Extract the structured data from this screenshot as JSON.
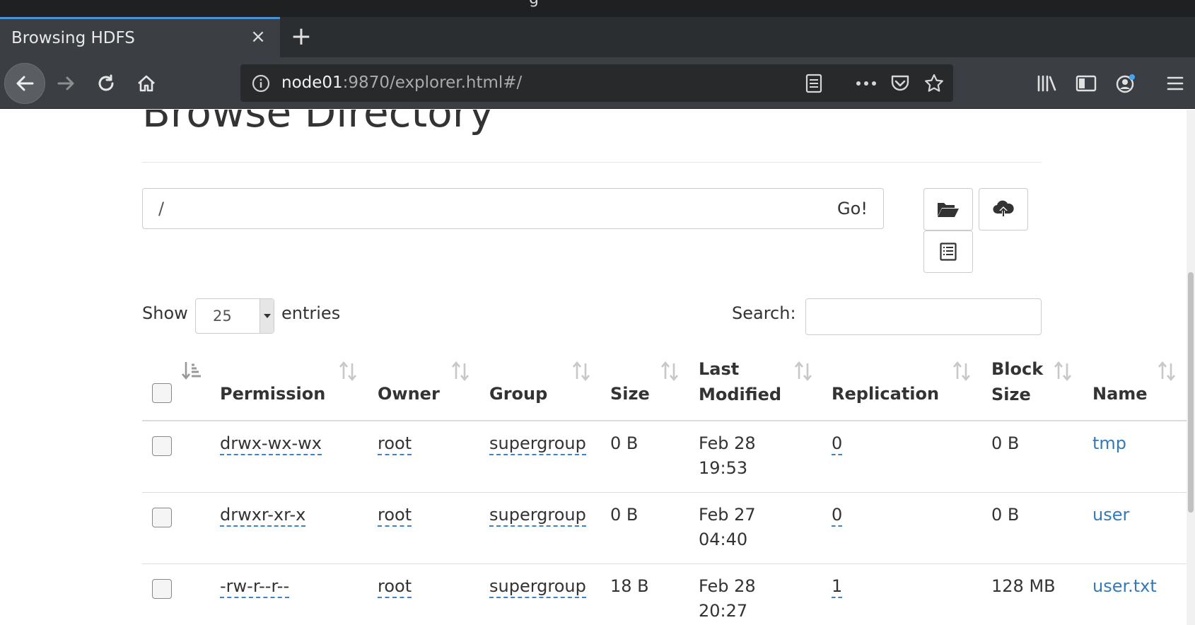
{
  "browser": {
    "title_fragment": "g",
    "tab": {
      "title": "Browsing HDFS"
    },
    "url": {
      "host": "node01",
      "rest": ":9870/explorer.html#/"
    }
  },
  "page": {
    "heading": "Browse Directory",
    "path_value": "/",
    "go_label": "Go!",
    "show_label": "Show",
    "entries_value": "25",
    "entries_label": "entries",
    "search_label": "Search:"
  },
  "table": {
    "headers": {
      "permission": "Permission",
      "owner": "Owner",
      "group": "Group",
      "size": "Size",
      "last_modified_1": "Last",
      "last_modified_2": "Modified",
      "replication": "Replication",
      "block_size_1": "Block",
      "block_size_2": "Size",
      "name": "Name"
    },
    "rows": [
      {
        "permission": "drwx-wx-wx",
        "owner": "root",
        "group": "supergroup",
        "size": "0 B",
        "date": "Feb 28",
        "time": "19:53",
        "replication": "0",
        "block_size": "0 B",
        "name": "tmp"
      },
      {
        "permission": "drwxr-xr-x",
        "owner": "root",
        "group": "supergroup",
        "size": "0 B",
        "date": "Feb 27",
        "time": "04:40",
        "replication": "0",
        "block_size": "0 B",
        "name": "user"
      },
      {
        "permission": "-rw-r--r--",
        "owner": "root",
        "group": "supergroup",
        "size": "18 B",
        "date": "Feb 28",
        "time": "20:27",
        "replication": "1",
        "block_size": "128 MB",
        "name": "user.txt"
      }
    ]
  }
}
